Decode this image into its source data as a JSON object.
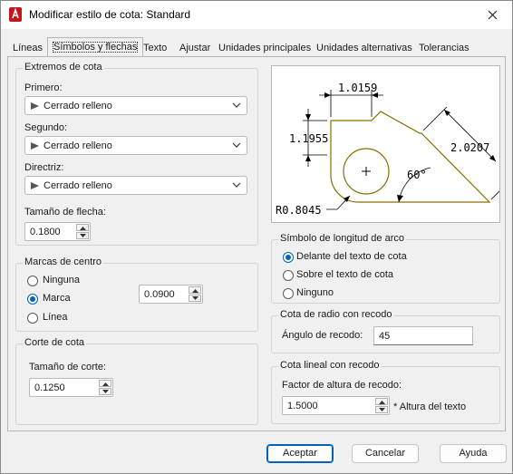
{
  "window": {
    "title": "Modificar estilo de cota: Standard"
  },
  "tabs": [
    {
      "label": "Líneas",
      "active": false
    },
    {
      "label": "Símbolos y flechas",
      "active": true
    },
    {
      "label": "Texto",
      "active": false
    },
    {
      "label": "Ajustar",
      "active": false
    },
    {
      "label": "Unidades principales",
      "active": false
    },
    {
      "label": "Unidades alternativas",
      "active": false
    },
    {
      "label": "Tolerancias",
      "active": false
    }
  ],
  "arrowheads": {
    "title": "Extremos de cota",
    "first": {
      "label": "Primero:",
      "value": "Cerrado relleno"
    },
    "second": {
      "label": "Segundo:",
      "value": "Cerrado relleno"
    },
    "leader": {
      "label": "Directriz:",
      "value": "Cerrado relleno"
    },
    "size": {
      "label": "Tamaño de flecha:",
      "value": "0.1800"
    }
  },
  "center_marks": {
    "title": "Marcas de centro",
    "options": [
      {
        "label": "Ninguna",
        "selected": false
      },
      {
        "label": "Marca",
        "selected": true
      },
      {
        "label": "Línea",
        "selected": false
      }
    ],
    "size_value": "0.0900"
  },
  "dim_break": {
    "title": "Corte de cota",
    "size": {
      "label": "Tamaño de corte:",
      "value": "0.1250"
    }
  },
  "preview": {
    "labels": {
      "top_dim": "1.0159",
      "left_dim": "1.1955",
      "right_dim": "2.0207",
      "angle": "60°",
      "radius": "R0.8045"
    }
  },
  "arc_length": {
    "title": "Símbolo de longitud de arco",
    "options": [
      {
        "label": "Delante del texto de cota",
        "selected": true
      },
      {
        "label": "Sobre el texto de cota",
        "selected": false
      },
      {
        "label": "Ninguno",
        "selected": false
      }
    ]
  },
  "radius_jog": {
    "title": "Cota de radio con recodo",
    "angle": {
      "label": "Ángulo de recodo:",
      "value": "45"
    }
  },
  "linear_jog": {
    "title": "Cota lineal con recodo",
    "factor": {
      "label": "Factor de altura de recodo:",
      "value": "1.5000",
      "suffix": "* Altura del texto"
    }
  },
  "buttons": {
    "ok": "Aceptar",
    "cancel": "Cancelar",
    "help": "Ayuda"
  },
  "colors": {
    "accent": "#0062b8",
    "app_icon": "#c4171d",
    "preview_outline": "#8a6d00"
  }
}
